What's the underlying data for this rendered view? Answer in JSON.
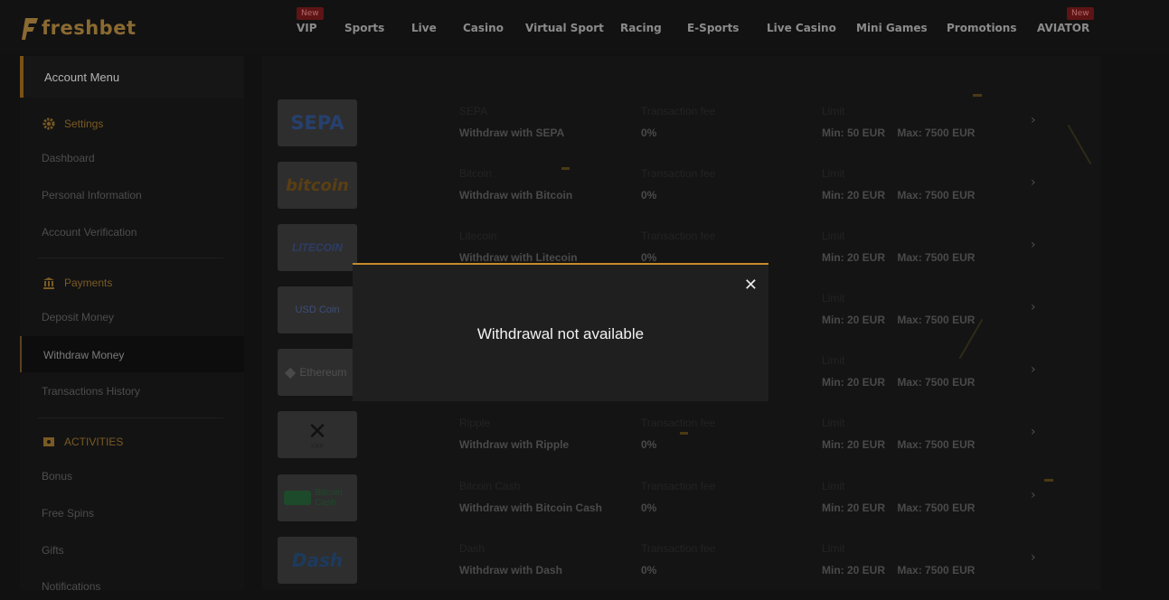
{
  "brand": {
    "logo_text": "freshbet",
    "accent": "#c78a2c"
  },
  "nav": {
    "items": [
      {
        "label": "VIP",
        "badge": "New"
      },
      {
        "label": "Sports"
      },
      {
        "label": "Live"
      },
      {
        "label": "Casino"
      },
      {
        "label": "Virtual Sport"
      },
      {
        "label": "Racing"
      },
      {
        "label": "E-Sports"
      },
      {
        "label": "Live Casino"
      },
      {
        "label": "Mini Games"
      },
      {
        "label": "Promotions"
      },
      {
        "label": "AVIATOR",
        "badge": "New"
      }
    ]
  },
  "sidebar": {
    "header": "Account Menu",
    "settings": {
      "title": "Settings",
      "icon": "gear-icon",
      "items": [
        "Dashboard",
        "Personal Information",
        "Account Verification"
      ]
    },
    "payments": {
      "title": "Payments",
      "icon": "bank-icon",
      "items": [
        "Deposit Money",
        "Withdraw Money",
        "Transactions History"
      ],
      "active": "Withdraw Money"
    },
    "activities": {
      "title": "ACTIVITIES",
      "icon": "ticket-icon",
      "items": [
        "Bonus",
        "Free Spins",
        "Gifts",
        "Notifications"
      ]
    }
  },
  "methods": [
    {
      "logo": "SEPA",
      "name": "SEPA",
      "action": "Withdraw with SEPA",
      "fee_label": "Transaction fee",
      "fee": "0%",
      "limit_label": "Limit",
      "min": "Min: 50 EUR",
      "max": "Max: 7500 EUR"
    },
    {
      "logo": "bitcoin",
      "name": "Bitcoin",
      "action": "Withdraw with Bitcoin",
      "fee_label": "Transaction fee",
      "fee": "0%",
      "limit_label": "Limit",
      "min": "Min: 20 EUR",
      "max": "Max: 7500 EUR"
    },
    {
      "logo": "LITECOIN",
      "name": "Litecoin",
      "action": "Withdraw with Litecoin",
      "fee_label": "Transaction fee",
      "fee": "0%",
      "limit_label": "Limit",
      "min": "Min: 20 EUR",
      "max": "Max: 7500 EUR"
    },
    {
      "logo": "USD Coin",
      "name": "",
      "action": "",
      "fee_label": "",
      "fee": "",
      "limit_label": "Limit",
      "min": "Min: 20 EUR",
      "max": "Max: 7500 EUR"
    },
    {
      "logo": "Ethereum",
      "name": "",
      "action": "",
      "fee_label": "",
      "fee": "",
      "limit_label": "Limit",
      "min": "Min: 20 EUR",
      "max": "Max: 7500 EUR"
    },
    {
      "logo": "XRP",
      "name": "Ripple",
      "action": "Withdraw with Ripple",
      "fee_label": "Transaction fee",
      "fee": "0%",
      "limit_label": "Limit",
      "min": "Min: 20 EUR",
      "max": "Max: 7500 EUR"
    },
    {
      "logo": "Bitcoin Cash",
      "name": "Bitcoin Cash",
      "action": "Withdraw with Bitcoin Cash",
      "fee_label": "Transaction fee",
      "fee": "0%",
      "limit_label": "Limit",
      "min": "Min: 20 EUR",
      "max": "Max: 7500 EUR"
    },
    {
      "logo": "Dash",
      "name": "Dash",
      "action": "Withdraw with Dash",
      "fee_label": "Transaction fee",
      "fee": "0%",
      "limit_label": "Limit",
      "min": "Min: 20 EUR",
      "max": "Max: 7500 EUR"
    }
  ],
  "modal": {
    "message": "Withdrawal not available",
    "close_icon": "close-icon"
  }
}
